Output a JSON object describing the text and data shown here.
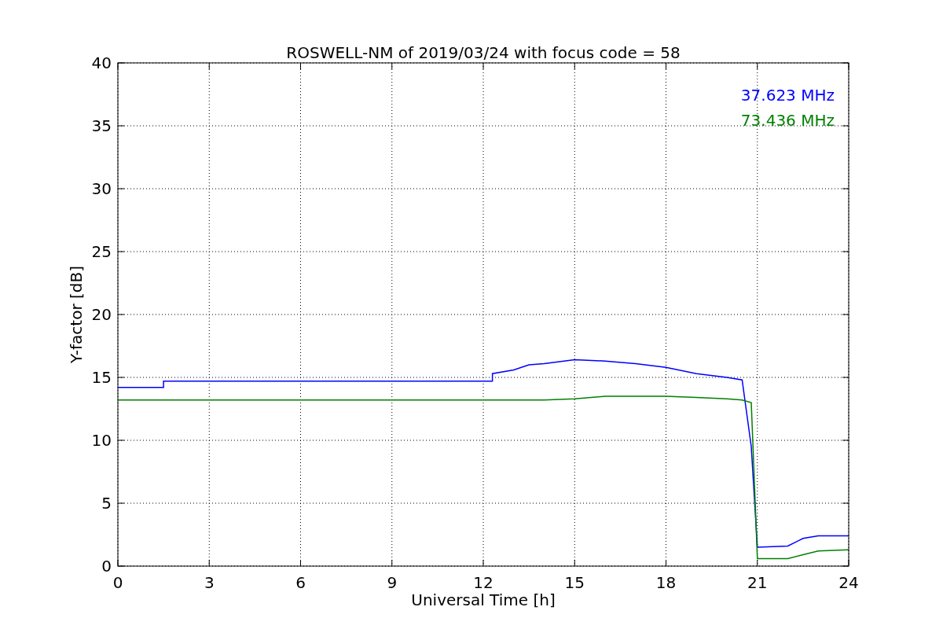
{
  "plot": {
    "chart_data": {
      "type": "line",
      "title": "ROSWELL-NM of 2019/03/24 with focus code = 58",
      "xlabel": "Universal Time [h]",
      "ylabel": "Y-factor [dB]",
      "x": [
        0,
        1.5,
        1.5,
        12.3,
        12.3,
        13,
        13.5,
        14,
        15,
        16,
        17,
        18,
        19,
        20,
        20.5,
        20.8,
        21,
        22,
        22.5,
        23,
        24
      ],
      "series": [
        {
          "name": "37.623 MHz",
          "color": "#0000ff",
          "values": [
            14.2,
            14.2,
            14.7,
            14.7,
            15.3,
            15.6,
            16.0,
            16.1,
            16.4,
            16.3,
            16.1,
            15.8,
            15.3,
            15.0,
            14.8,
            9.5,
            1.5,
            1.6,
            2.2,
            2.4,
            2.4
          ]
        },
        {
          "name": "73.436 MHz",
          "color": "#008000",
          "values": [
            13.2,
            13.2,
            13.2,
            13.2,
            13.2,
            13.2,
            13.2,
            13.2,
            13.3,
            13.5,
            13.5,
            13.5,
            13.4,
            13.3,
            13.2,
            13.0,
            0.6,
            0.6,
            0.9,
            1.2,
            1.3
          ]
        }
      ],
      "grid": true,
      "xlim": [
        0,
        24
      ],
      "ylim": [
        0,
        40
      ],
      "xticks": [
        0,
        3,
        6,
        9,
        12,
        15,
        18,
        21,
        24
      ],
      "yticks": [
        0,
        5,
        10,
        15,
        20,
        25,
        30,
        35,
        40
      ]
    }
  }
}
